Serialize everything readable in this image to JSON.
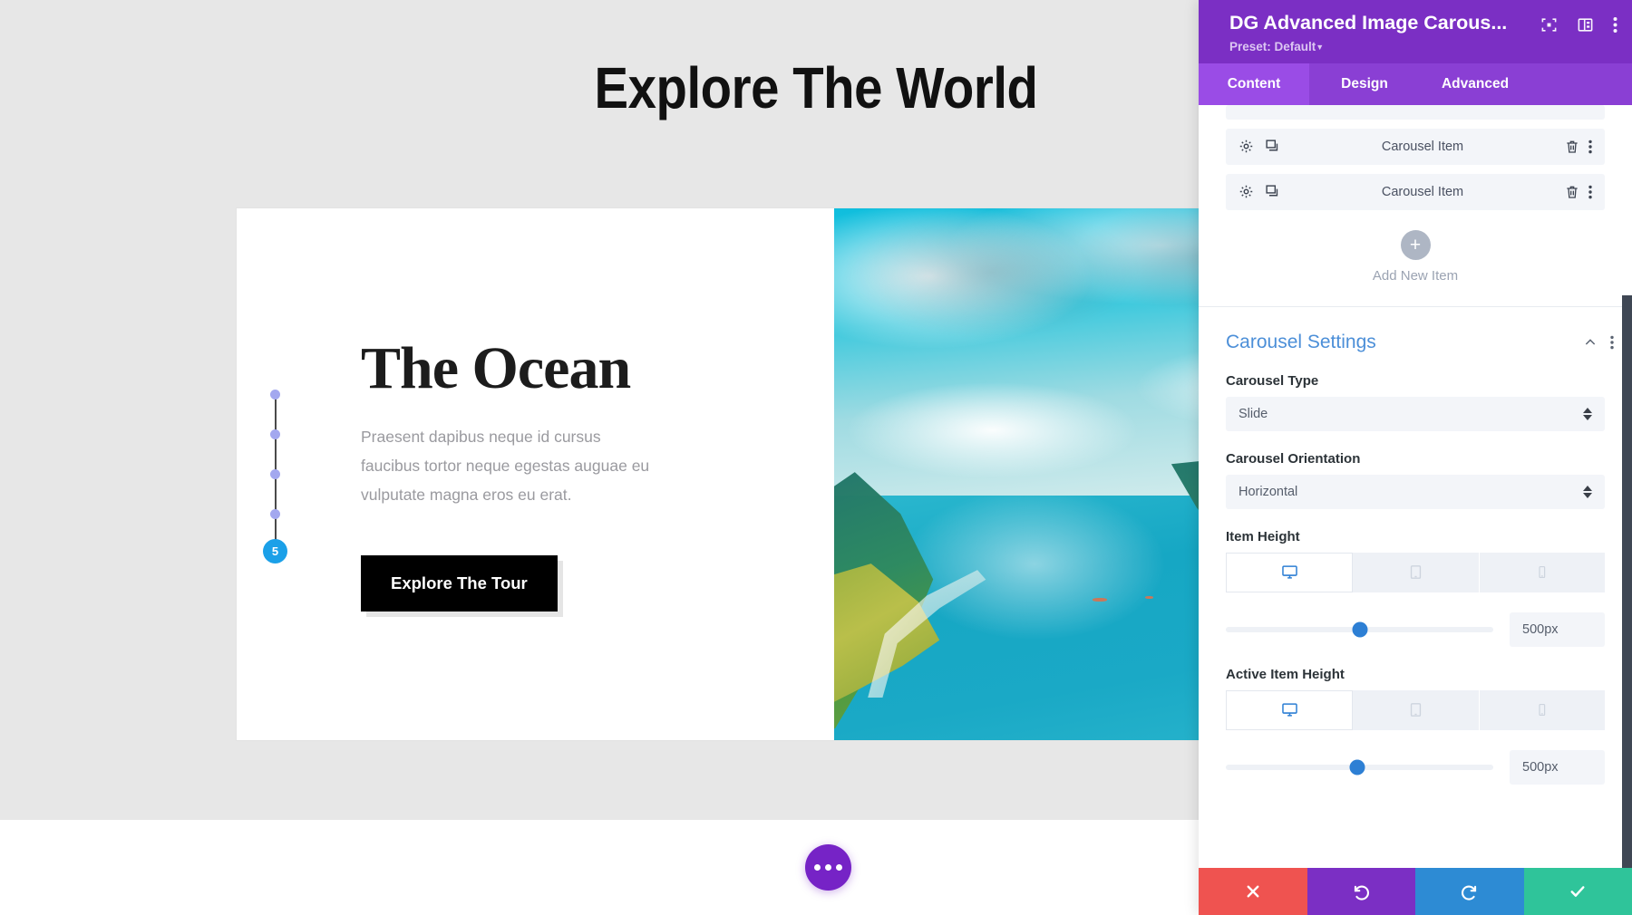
{
  "canvas": {
    "page_heading": "Explore The World",
    "slide": {
      "title": "The Ocean",
      "body": "Praesent dapibus neque id cursus faucibus tortor neque egestas auguae eu vulputate magna eros eu erat.",
      "cta_label": "Explore The Tour",
      "image_alt": "aerial-fjord-landscape"
    },
    "pagination": {
      "active_index_label": "5",
      "inactive_dot_count": 4,
      "active_color": "#1ba0e8",
      "dot_color": "#a3a8ef"
    },
    "fab": {
      "icon": "ellipsis-icon"
    }
  },
  "panel": {
    "title": "DG Advanced Image Carous...",
    "preset_label": "Preset: Default",
    "header_icons": [
      {
        "name": "focus-icon"
      },
      {
        "name": "panel-layout-icon"
      },
      {
        "name": "overflow-menu-icon"
      }
    ],
    "accent_purple": "#7b2fc4",
    "tabs": [
      {
        "label": "Content",
        "active": true
      },
      {
        "label": "Design",
        "active": false
      },
      {
        "label": "Advanced",
        "active": false
      }
    ],
    "items": [
      {
        "label": "Carousel Item"
      },
      {
        "label": "Carousel Item"
      }
    ],
    "add_new": {
      "label": "Add New Item",
      "icon": "plus-icon"
    },
    "section": {
      "title": "Carousel Settings",
      "collapse_icon": "chevron-up-icon",
      "menu_icon": "overflow-menu-icon",
      "fields": [
        {
          "type": "select",
          "label": "Carousel Type",
          "value": "Slide"
        },
        {
          "type": "select",
          "label": "Carousel Orientation",
          "value": "Horizontal"
        },
        {
          "type": "range",
          "label": "Item Height",
          "value": "500px",
          "slider_percent": 50,
          "devices": [
            {
              "name": "desktop-icon",
              "active": true
            },
            {
              "name": "tablet-icon",
              "active": false
            },
            {
              "name": "phone-icon",
              "active": false
            }
          ]
        },
        {
          "type": "range",
          "label": "Active Item Height",
          "value": "500px",
          "slider_percent": 49,
          "devices": [
            {
              "name": "desktop-icon",
              "active": true
            },
            {
              "name": "tablet-icon",
              "active": false
            },
            {
              "name": "phone-icon",
              "active": false
            }
          ]
        }
      ]
    },
    "footer_buttons": [
      {
        "name": "cancel-button",
        "icon": "close-icon",
        "color": "#ef5350"
      },
      {
        "name": "undo-button",
        "icon": "undo-icon",
        "color": "#7b2fc4"
      },
      {
        "name": "redo-button",
        "icon": "redo-icon",
        "color": "#2d8bd4"
      },
      {
        "name": "save-button",
        "icon": "check-icon",
        "color": "#2fc49a"
      }
    ]
  }
}
